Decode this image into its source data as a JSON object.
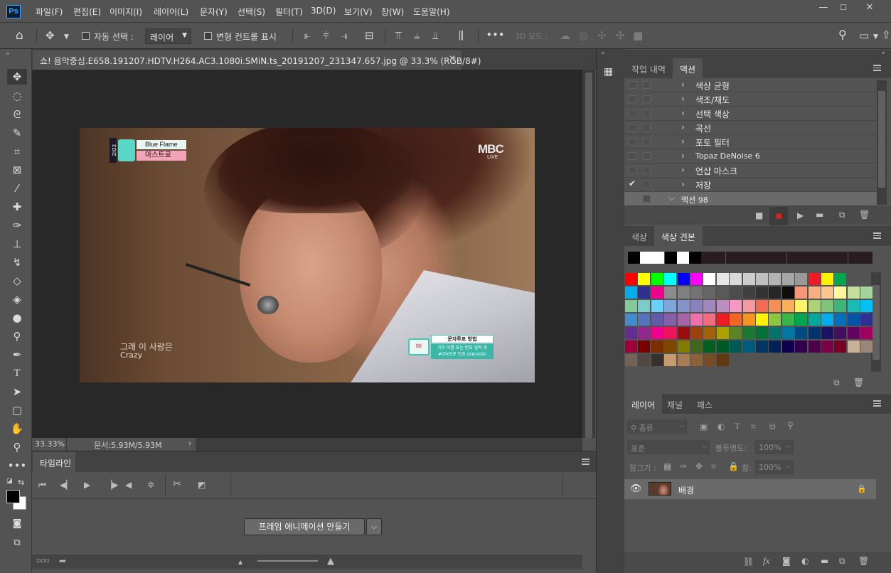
{
  "app": {
    "logo_text": "Ps",
    "menu": [
      "파일(F)",
      "편집(E)",
      "이미지(I)",
      "레이어(L)",
      "문자(Y)",
      "선택(S)",
      "필터(T)",
      "3D(D)",
      "보기(V)",
      "창(W)",
      "도움말(H)"
    ],
    "window_controls": [
      "—",
      "☐",
      "✕"
    ]
  },
  "options_bar": {
    "auto_select_label": "자동 선택 :",
    "auto_select_target": "레이어",
    "transform_controls_label": "변형 컨트롤 표시",
    "more": "•••",
    "mode_3d_label": "3D 모드 :"
  },
  "document": {
    "tab_title": "쇼! 음악중심.E658.191207.HDTV.H264.AC3.1080i.SMiN.ts_20191207_231347.657.jpg @ 33.3% (RGB/8#)",
    "zoom": "33.33%",
    "doc_size": "문서:5.93M/5.93M",
    "image": {
      "song_title": "Blue Flame",
      "artist": "아스트로",
      "channel_logo": "MBC",
      "channel_sub": "LIVE",
      "subtitle_ko": "그래 이 사랑은",
      "subtitle_en": "Crazy",
      "vote_title": "문자투표 방법",
      "vote_line1": "가수 이름 또는 번호 입력 후",
      "vote_line2": "#0505로 전송",
      "vote_line2_small": "(유료100원)",
      "side_logo": "EDIZ"
    }
  },
  "timeline": {
    "tab": "타임라인",
    "create_button": "프레임 애니메이션 만들기"
  },
  "actions_panel": {
    "tabs": [
      "작업 내역",
      "액션"
    ],
    "active_tab": "액션",
    "items": [
      {
        "label": "색상 균형",
        "checked": false
      },
      {
        "label": "색조/채도",
        "checked": false
      },
      {
        "label": "선택 색상",
        "checked": false
      },
      {
        "label": "곡선",
        "checked": false
      },
      {
        "label": "포토 필터",
        "checked": false
      },
      {
        "label": "Topaz DeNoise 6",
        "checked": false
      },
      {
        "label": "언샵 마스크",
        "checked": false
      },
      {
        "label": "저장",
        "checked": true
      }
    ],
    "set_label": "액션 98"
  },
  "swatches_panel": {
    "tabs": [
      "색상",
      "색상 견본"
    ],
    "active_tab": "색상 견본",
    "recent": [
      "#000000",
      "#ffffff",
      "#ffffff",
      "#000000",
      "#ffffff",
      "#000000",
      "#2a1d22",
      "#2a1d22",
      "#2a1d22",
      "#2a1d22",
      "#2a1d22",
      "#2a1d22",
      "#2a1d22",
      "#2a1d22",
      "#2a1d22",
      "#2a1d22",
      "#2a1d22",
      "#2a1d22",
      "#2a1d22",
      "#2a1d22"
    ],
    "rows": [
      [
        "#ff0000",
        "#ffff00",
        "#00ff00",
        "#00ffff",
        "#0000ff",
        "#ff00ff",
        "#ffffff",
        "#e6e6e6",
        "#d9d9d9",
        "#cccccc",
        "#bfbfbf",
        "#b3b3b3",
        "#a6a6a6",
        "#999999",
        "#ed1c24",
        "#fff200",
        "#00a651"
      ],
      [
        "#00aeef",
        "#2e3192",
        "#ec008c",
        "#8c8c8c",
        "#808080",
        "#737373",
        "#666666",
        "#595959",
        "#4d4d4d",
        "#404040",
        "#333333",
        "#262626",
        "#0d0d0d",
        "#f7977a",
        "#f9ad81",
        "#fdc68a",
        "#fff79a",
        "#c4df9b",
        "#a3d39c"
      ],
      [
        "#82ca9c",
        "#7accc8",
        "#6dcff6",
        "#7da7d9",
        "#8393ca",
        "#8781bd",
        "#a187be",
        "#bc8dbf",
        "#f49ac2",
        "#f6989d",
        "#f26c4f",
        "#f68e56",
        "#fbaf5c",
        "#fff467",
        "#acd372",
        "#7cc576",
        "#3bb878",
        "#1abbb4",
        "#00bff3"
      ],
      [
        "#438ccb",
        "#5574b9",
        "#605ca8",
        "#855fa8",
        "#a763a8",
        "#f06ea9",
        "#f26d7d",
        "#ed1c24",
        "#f26522",
        "#f7941d",
        "#fff200",
        "#8dc63f",
        "#39b54a",
        "#00a651",
        "#00a99d",
        "#00aeef",
        "#0072bc",
        "#0054a6",
        "#2e3192"
      ],
      [
        "#662d91",
        "#92278f",
        "#ec008c",
        "#ed145b",
        "#9e0b0f",
        "#a0410d",
        "#a3620a",
        "#aba000",
        "#598527",
        "#1a7b30",
        "#007236",
        "#00746b",
        "#0076a3",
        "#004a80",
        "#003471",
        "#1b1464",
        "#440e62",
        "#630460",
        "#9e005d"
      ],
      [
        "#9e0039",
        "#790000",
        "#7b2e00",
        "#7d4900",
        "#827b00",
        "#406618",
        "#005e20",
        "#005826",
        "#005952",
        "#005b7f",
        "#003663",
        "#002157",
        "#0d004c",
        "#32004b",
        "#4b0049",
        "#7b0046",
        "#7a0026",
        "#c7b299",
        "#998675"
      ],
      [
        "#736357",
        "#534741",
        "#37302d",
        "#c69c6d",
        "#a67c52",
        "#8c6239",
        "#754c24",
        "#603913"
      ]
    ]
  },
  "layers_panel": {
    "tabs": [
      "레이어",
      "채널",
      "패스"
    ],
    "active_tab": "레이어",
    "filter_label": "종류",
    "blend_mode": "표준",
    "opacity_label": "불투명도:",
    "opacity_value": "100%",
    "lock_label": "잠그기 :",
    "fill_label": "칠:",
    "fill_value": "100%",
    "layer_name": "배경"
  }
}
